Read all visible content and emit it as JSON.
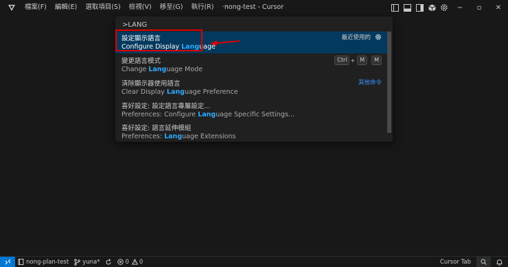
{
  "titlebar": {
    "menu": [
      "檔案(F)",
      "編輯(E)",
      "選取項目(S)",
      "檢視(V)",
      "移至(G)",
      "執行(R)",
      "···"
    ],
    "title": "nong-test - Cursor",
    "window_controls": {
      "minimize": "−",
      "maximize": "▫",
      "close": "✕"
    }
  },
  "palette": {
    "input_value": ">LANG",
    "results": [
      {
        "title": "設定顯示語言",
        "detail": {
          "pre": "Configure Display ",
          "hl": "Lang",
          "post": "uage"
        },
        "right_label": "最近使用的",
        "selected": true
      },
      {
        "title": "變更語言模式",
        "detail": {
          "pre": "Change ",
          "hl": "Lang",
          "post": "uage Mode"
        },
        "keys": [
          "Ctrl",
          "M",
          "M"
        ]
      },
      {
        "title": "清除顯示器使用語言",
        "detail": {
          "pre": "Clear Display ",
          "hl": "Lang",
          "post": "uage Preference"
        },
        "right_label": "其他命令"
      },
      {
        "title": "喜好設定: 設定語言專屬設定...",
        "detail": {
          "pre": "Preferences: Configure ",
          "hl": "Lang",
          "post": "uage Specific Settings..."
        }
      },
      {
        "title": "喜好設定: 語言延伸模組",
        "detail": {
          "pre": "Preferences: ",
          "hl": "Lang",
          "post": "uage Extensions"
        }
      }
    ]
  },
  "statusbar": {
    "remote_icon": "remote-icon",
    "project": "nong-plan-test",
    "branch": "yuna*",
    "errors": "0",
    "warnings": "0",
    "cursor_tab": "Cursor Tab"
  },
  "colors": {
    "accent": "#0078d4",
    "selection": "#04395e",
    "highlight": "#2aaaff",
    "annotation": "#e00000"
  }
}
